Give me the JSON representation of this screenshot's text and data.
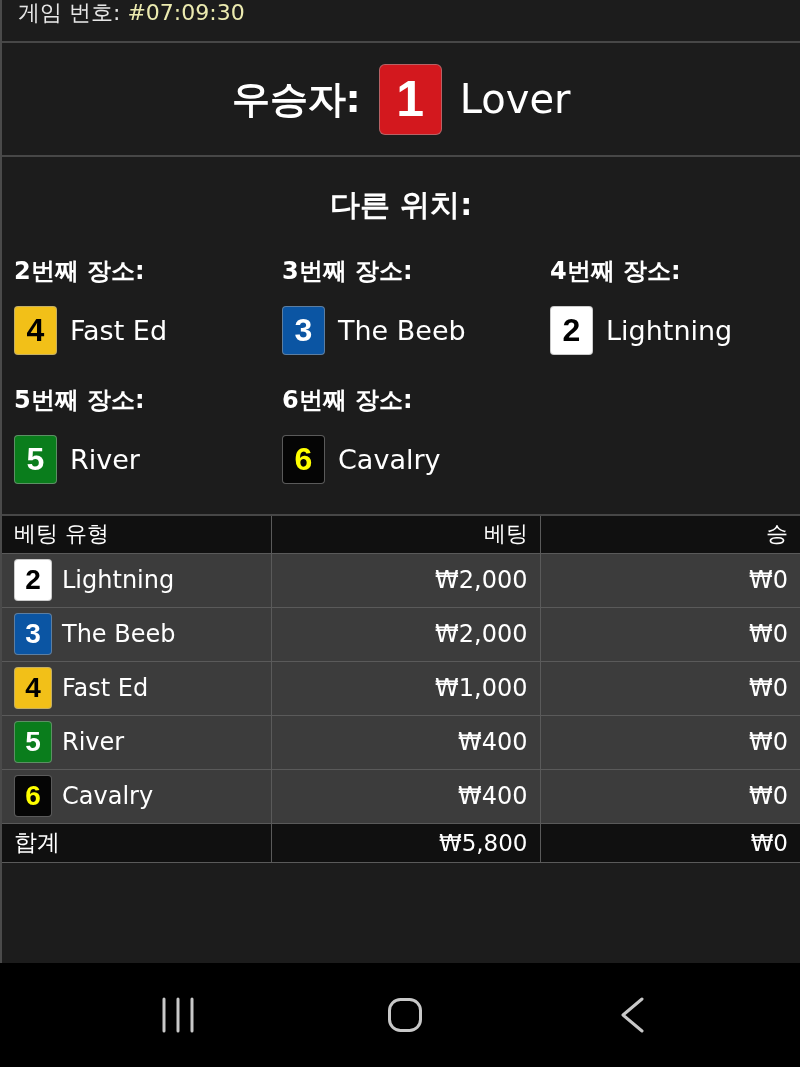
{
  "header": {
    "label": "게임 번호:",
    "value": "#07:09:30"
  },
  "winner": {
    "label": "우승자:",
    "number": "1",
    "name": "Lover",
    "color": "#d3181e"
  },
  "other_positions": {
    "title": "다른 위치:",
    "places": [
      {
        "label": "2번째 장소:",
        "number": "4",
        "name": "Fast Ed",
        "color": "#f2c018"
      },
      {
        "label": "3번째 장소:",
        "number": "3",
        "name": "The Beeb",
        "color": "#0b55a3"
      },
      {
        "label": "4번째 장소:",
        "number": "2",
        "name": "Lightning",
        "color": "#ffffff"
      },
      {
        "label": "5번째 장소:",
        "number": "5",
        "name": "River",
        "color": "#0a7d1c"
      },
      {
        "label": "6번째 장소:",
        "number": "6",
        "name": "Cavalry",
        "color": "#050505"
      }
    ]
  },
  "bets_table": {
    "columns": [
      "베팅 유형",
      "베팅",
      "승"
    ],
    "rows": [
      {
        "number": "2",
        "name": "Lightning",
        "color": "#ffffff",
        "bet": "₩2,000",
        "win": "₩0"
      },
      {
        "number": "3",
        "name": "The Beeb",
        "color": "#0b55a3",
        "bet": "₩2,000",
        "win": "₩0"
      },
      {
        "number": "4",
        "name": "Fast Ed",
        "color": "#f2c018",
        "bet": "₩1,000",
        "win": "₩0"
      },
      {
        "number": "5",
        "name": "River",
        "color": "#0a7d1c",
        "bet": "₩400",
        "win": "₩0"
      },
      {
        "number": "6",
        "name": "Cavalry",
        "color": "#050505",
        "bet": "₩400",
        "win": "₩0"
      }
    ],
    "total": {
      "label": "합계",
      "bet": "₩5,800",
      "win": "₩0"
    }
  },
  "nav_bar": {
    "buttons": [
      {
        "kind": "recents"
      },
      {
        "kind": "home"
      },
      {
        "kind": "back"
      }
    ]
  }
}
